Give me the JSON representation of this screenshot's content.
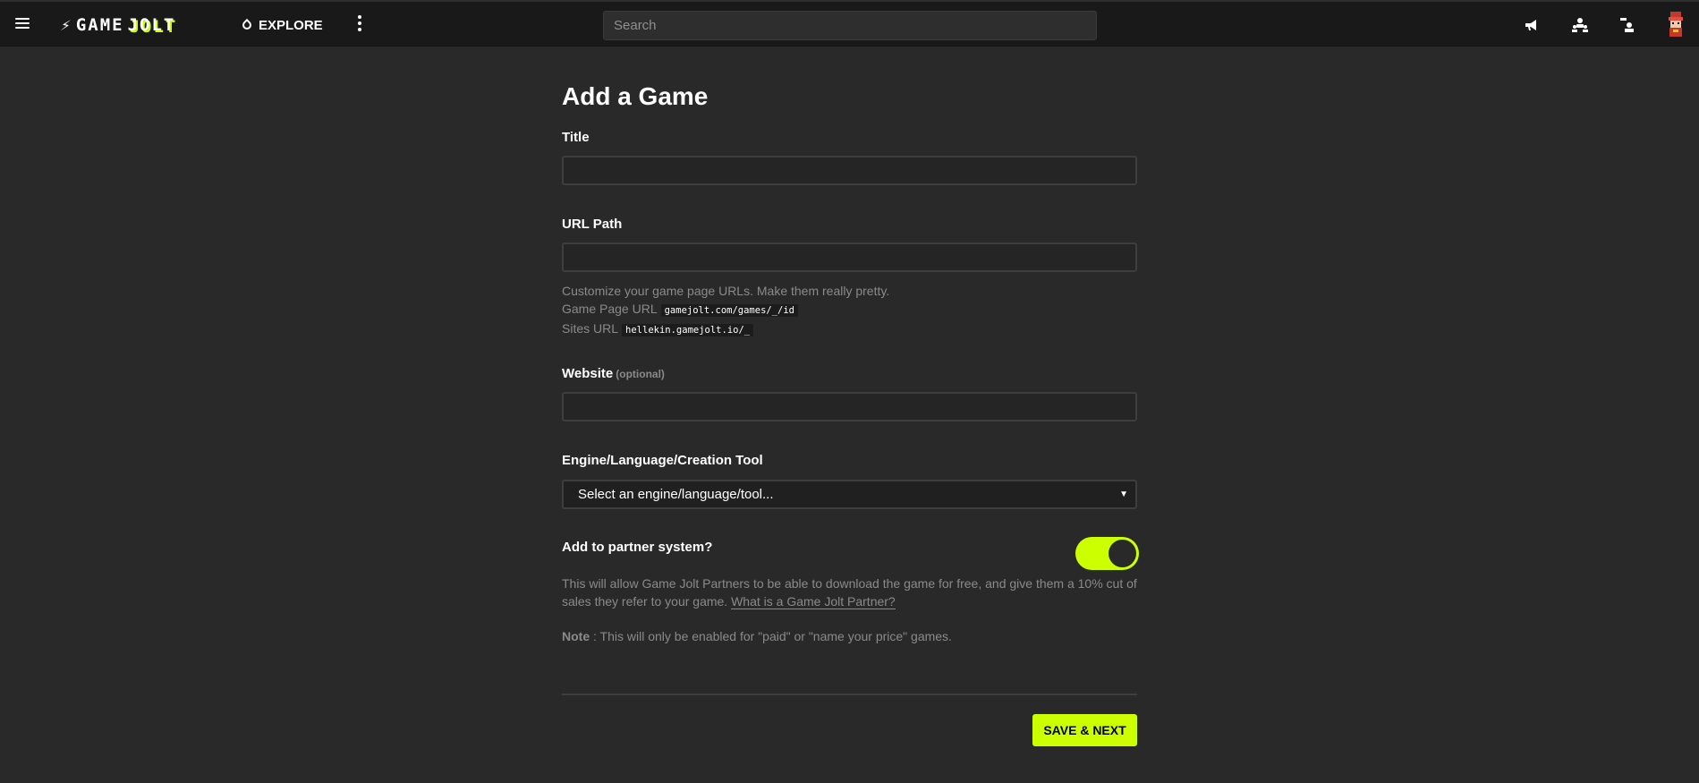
{
  "header": {
    "logo_text_a": "GAME",
    "logo_text_b": "JOLT",
    "explore_label": "EXPLORE",
    "search_placeholder": "Search",
    "icons": [
      "menu-icon",
      "explore-icon",
      "more-options-icon",
      "announcement-icon",
      "friends-icon",
      "activity-icon",
      "avatar"
    ]
  },
  "form": {
    "title": "Add a Game",
    "title_field": {
      "label": "Title",
      "value": ""
    },
    "url_field": {
      "label": "URL Path",
      "value": "",
      "help_line": "Customize your game page URLs. Make them really pretty.",
      "game_page_label": "Game Page URL",
      "game_page_url": "gamejolt.com/games/_/id",
      "sites_label": "Sites URL",
      "sites_url": "hellekin.gamejolt.io/_"
    },
    "website_field": {
      "label": "Website",
      "optional": "(optional)",
      "value": ""
    },
    "engine_field": {
      "label": "Engine/Language/Creation Tool",
      "selected": "Select an engine/language/tool..."
    },
    "partner": {
      "label": "Add to partner system?",
      "enabled": true,
      "help_text": "This will allow Game Jolt Partners to be able to download the game for free, and give them a 10% cut of sales they refer to your game.",
      "help_link": "What is a Game Jolt Partner?",
      "note_label": "Note",
      "note_text": " : This will only be enabled for \"paid\" or \"name your price\" games."
    },
    "submit_label": "SAVE & NEXT"
  },
  "colors": {
    "accent": "#ccff00",
    "background": "#292929",
    "topbar": "#191919",
    "muted_text": "#8a8a8a"
  }
}
